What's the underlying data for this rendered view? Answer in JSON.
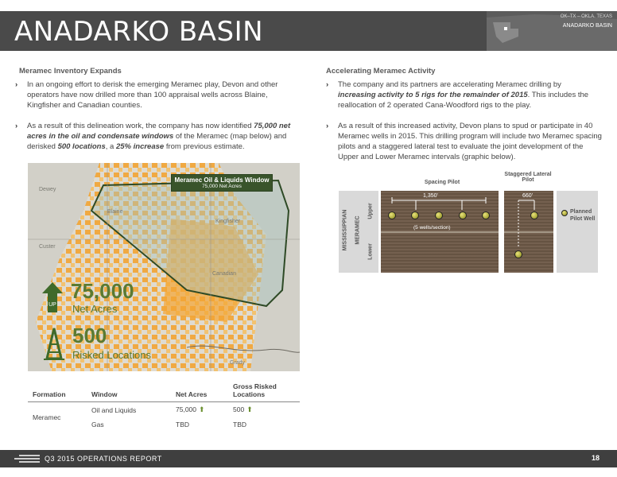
{
  "header": {
    "title": "ANADARKO BASIN",
    "inset_map_state": "OK–TX – OKLA. TEXAS",
    "inset_map_basin": "ANADARKO BASIN"
  },
  "left_column": {
    "heading": "Meramec Inventory Expands",
    "bullets": [
      {
        "parts": [
          "In an ongoing effort to derisk the emerging Meramec play, Devon and other operators have now drilled more than 100 appraisal wells across Blaine, Kingfisher and Canadian counties."
        ]
      },
      {
        "p1": "As a result of this delineation work, the company has now identified ",
        "b1": "75,000 net acres in the oil and condensate windows",
        "p2": " of the Meramec (map below) and derisked ",
        "b2": "500 locations",
        "p3": ", a ",
        "b3": "25% increase",
        "p4": " from previous estimate."
      }
    ]
  },
  "right_column": {
    "heading": "Accelerating Meramec Activity",
    "bullet1": {
      "p1": "The company and its partners are accelerating Meramec drilling by ",
      "b1": "increasing activity to 5 rigs for the remainder of 2015",
      "p2": ". This includes the reallocation of 2 operated Cana-Woodford rigs to the play."
    },
    "bullet2": {
      "p1": "As a result of this increased activity, Devon plans to spud or participate in 40 Meramec wells in 2015. This drilling program will include two Meramec spacing pilots and a staggered lateral test to evaluate the joint development of the Upper and Lower Meramec intervals (graphic below)."
    }
  },
  "map": {
    "window_title": "Meramec Oil & Liquids Window",
    "window_sub": "75,000 Net Acres",
    "counties": [
      "Dewey",
      "Blaine",
      "Kingfisher",
      "Custer",
      "Canadian",
      "Grady"
    ],
    "stat1_value": "75,000",
    "stat1_label": "Net Acres",
    "stat1_arrow": "UP",
    "stat2_value": "500",
    "stat2_label": "Risked Locations",
    "acreage_color": "#f3a533",
    "window_color": "#39542b"
  },
  "table": {
    "headers": [
      "Formation",
      "Window",
      "Net Acres",
      "Gross Risked Locations"
    ],
    "formation": "Meramec",
    "rows": [
      {
        "window": "Oil and Liquids",
        "net": "75,000",
        "gross": "500"
      },
      {
        "window": "Gas",
        "net": "TBD",
        "gross": "TBD"
      }
    ]
  },
  "diagram": {
    "spacing_pilot": "Spacing Pilot",
    "staggered_pilot": "Staggered Lateral Pilot",
    "system": "MISSISSIPPIAN",
    "formation": "MERAMEC",
    "upper": "Upper",
    "lower": "Lower",
    "spacing_dim": "1,350'",
    "spacing_note": "(5 wells/section)",
    "staggered_dim": "660'",
    "legend": "Planned Pilot Well"
  },
  "footer": {
    "text": "Q3 2015  OPERATIONS REPORT",
    "page": "18"
  }
}
